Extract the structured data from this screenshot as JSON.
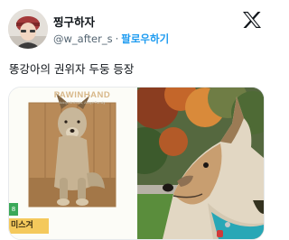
{
  "author": {
    "display_name": "찡구하자",
    "handle": "@w_after_s",
    "separator": "·",
    "follow_label": "팔로우하기"
  },
  "brand_icon": "x-logo-icon",
  "tweet": {
    "text": "똥강아의 권위자 두둥 등장"
  },
  "media": {
    "photo1": {
      "brand": "PAWINHAND",
      "tagline": "Adopt Animals, Adopt Family",
      "tag": "8",
      "label": "미스겨"
    }
  },
  "colors": {
    "accent": "#1d9bf0",
    "text": "#0f1419",
    "muted": "#536471",
    "brand_text": "#d8b88a",
    "label_yellow": "#f4c95c",
    "tag_green": "#3aa857"
  }
}
